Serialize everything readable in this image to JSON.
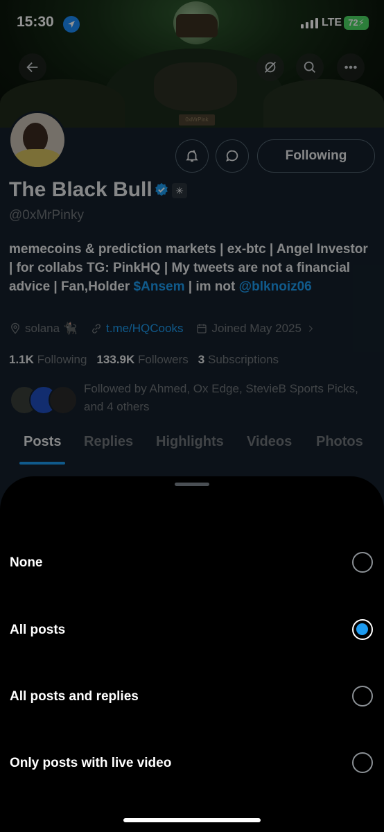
{
  "status_bar": {
    "time": "15:30",
    "network": "LTE",
    "battery": "72"
  },
  "banner": {
    "tag_text": "0xMrPink"
  },
  "profile": {
    "display_name": "The Black Bull",
    "handle": "@0xMrPinky",
    "following_button": "Following",
    "bio": {
      "part1": "memecoins & prediction markets | ex-btc | Angel Investor | for collabs TG: PinkHQ | My tweets are not a financial advice | Fan,Holder ",
      "link1": "$Ansem",
      "part2": " | im not ",
      "link2": "@blknoiz06"
    },
    "location": "solana 🐈‍⬛",
    "website": "t.me/HQCooks",
    "joined": "Joined May 2025",
    "stats": {
      "following_count": "1.1K",
      "following_label": "Following",
      "followers_count": "133.9K",
      "followers_label": "Followers",
      "subscriptions_count": "3",
      "subscriptions_label": "Subscriptions"
    },
    "followed_by": "Followed by Ahmed, Ox Edge, StevieB Sports Picks, and 4 others",
    "tabs": [
      "Posts",
      "Replies",
      "Highlights",
      "Videos",
      "Photos"
    ]
  },
  "sheet": {
    "options": [
      {
        "label": "None",
        "selected": false
      },
      {
        "label": "All posts",
        "selected": true
      },
      {
        "label": "All posts and replies",
        "selected": false
      },
      {
        "label": "Only posts with live video",
        "selected": false
      }
    ]
  },
  "colors": {
    "accent": "#1d9bf0",
    "background": "#15202b",
    "sheet": "#000000"
  }
}
